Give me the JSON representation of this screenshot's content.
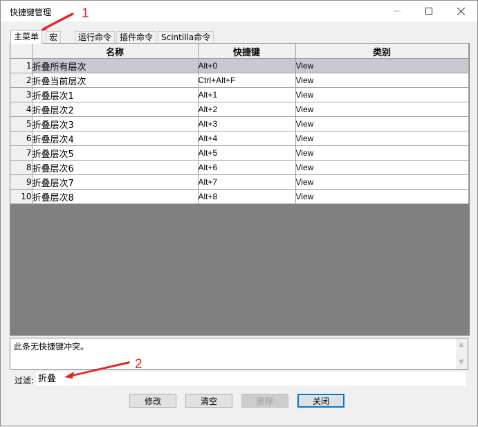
{
  "window": {
    "title": "快捷键管理"
  },
  "tabs": [
    {
      "label": "主菜单",
      "active": true
    },
    {
      "label": "宏"
    },
    {
      "label": "运行命令"
    },
    {
      "label": "插件命令"
    },
    {
      "label": "Scintilla命令"
    }
  ],
  "grid": {
    "columns": [
      "名称",
      "快捷键",
      "类别"
    ],
    "rows": [
      {
        "num": "1",
        "name": "折叠所有层次",
        "shortcut": "Alt+0",
        "category": "View",
        "selected": true
      },
      {
        "num": "2",
        "name": "折叠当前层次",
        "shortcut": "Ctrl+Alt+F",
        "category": "View"
      },
      {
        "num": "3",
        "name": "折叠层次1",
        "shortcut": "Alt+1",
        "category": "View"
      },
      {
        "num": "4",
        "name": "折叠层次2",
        "shortcut": "Alt+2",
        "category": "View"
      },
      {
        "num": "5",
        "name": "折叠层次3",
        "shortcut": "Alt+3",
        "category": "View"
      },
      {
        "num": "6",
        "name": "折叠层次4",
        "shortcut": "Alt+4",
        "category": "View"
      },
      {
        "num": "7",
        "name": "折叠层次5",
        "shortcut": "Alt+5",
        "category": "View"
      },
      {
        "num": "8",
        "name": "折叠层次6",
        "shortcut": "Alt+6",
        "category": "View"
      },
      {
        "num": "9",
        "name": "折叠层次7",
        "shortcut": "Alt+7",
        "category": "View"
      },
      {
        "num": "10",
        "name": "折叠层次8",
        "shortcut": "Alt+8",
        "category": "View"
      }
    ]
  },
  "conflict": {
    "text": "此条无快捷键冲突。"
  },
  "filter": {
    "label": "过滤:",
    "value": "折叠"
  },
  "buttons": {
    "modify": "修改",
    "clear": "清空",
    "delete": "删除",
    "close": "关闭"
  },
  "annotations": {
    "first": "1",
    "second": "2",
    "color": "#e8251d"
  }
}
